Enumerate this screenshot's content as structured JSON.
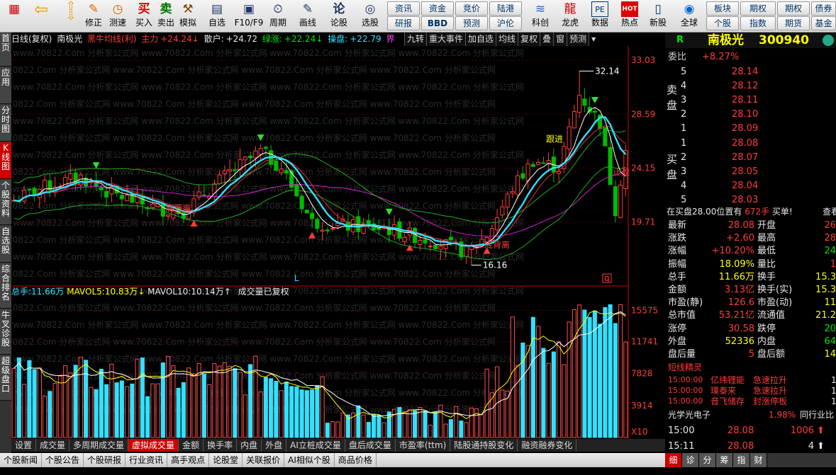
{
  "toolbar": {
    "left": [
      {
        "name": "home-button",
        "label": "",
        "icon": "▦"
      },
      {
        "name": "back-button",
        "label": "",
        "icon": "⇦"
      },
      {
        "name": "prev-button",
        "label": "",
        "icon": "⇧"
      },
      {
        "name": "edit-button",
        "label": "修正",
        "icon": "✎"
      },
      {
        "name": "test-button",
        "label": "测速",
        "icon": "◷"
      },
      {
        "name": "buy-button",
        "label": "买入",
        "icon": "买"
      },
      {
        "name": "sell-button",
        "label": "卖出",
        "icon": "卖"
      },
      {
        "name": "simulate-button",
        "label": "模拟",
        "icon": "⚒"
      },
      {
        "name": "watchlist-button",
        "label": "自选",
        "icon": "▤"
      },
      {
        "name": "f10-button",
        "label": "F10/F9",
        "icon": "▣"
      },
      {
        "name": "period-button",
        "label": "周期",
        "icon": "⏲"
      },
      {
        "name": "draw-button",
        "label": "画线",
        "icon": "✎"
      },
      {
        "name": "discuss-button",
        "label": "论股",
        "icon": "论"
      },
      {
        "name": "select-stock-button",
        "label": "选股",
        "icon": "◎"
      }
    ],
    "mid": [
      [
        "资讯",
        "资金",
        "竞价",
        "陆港"
      ],
      [
        "研报",
        "BBD",
        "预测",
        "沪伦"
      ]
    ],
    "right": [
      {
        "name": "kechuang-button",
        "label": "科创",
        "icon": "≋"
      },
      {
        "name": "longhu-button",
        "label": "龙虎",
        "icon": "龍"
      },
      {
        "name": "data-button",
        "label": "数据",
        "icon": "PE"
      },
      {
        "name": "hot-button",
        "label": "热点",
        "icon": "HOT"
      },
      {
        "name": "ipo-button",
        "label": "新股",
        "icon": "▯"
      },
      {
        "name": "global-button",
        "label": "全球",
        "icon": "◉"
      }
    ],
    "far": [
      [
        "板块",
        "期权",
        "期权",
        "债券"
      ],
      [
        "个股",
        "指数",
        "期货",
        "基金"
      ]
    ]
  },
  "lefttabs": [
    "首页",
    "应用",
    "分时图",
    "K线图",
    "个股资料",
    "自选股",
    "综合排名",
    "牛叉诊股",
    "超级盘口"
  ],
  "header": {
    "mode": "日线(复权)",
    "name": "南极光",
    "indicator": "黑牛均线(利)",
    "zhuli_label": "主力",
    "zhuli_val": "+24.24↓",
    "sanhu_label": "散户:",
    "sanhu_val": "+24.72",
    "lvzhang_label": "绿涨:",
    "lvzhang_val": "+22.24↓",
    "caopan_label": "操盘:",
    "caopan_val": "+22.79",
    "jie": "界"
  },
  "chart_tools": [
    "九转",
    "重大事件",
    "加自选",
    "均线",
    "复权",
    "叠",
    "窗",
    "预测"
  ],
  "watermark": "www.70822.Com 分析家公式网",
  "price_axis": [
    "33.03",
    "28.59",
    "24.15",
    "19.71"
  ],
  "vol_axis": [
    "15575",
    "11741",
    "7828",
    "3914",
    "X10"
  ],
  "annotations": {
    "high": "32.14",
    "low": "16.16",
    "jinjing": "跟进",
    "dibei": "底背离",
    "zhiying": "止盈",
    "escape": "逃离",
    "dibei2": "底背离",
    "L": "L",
    "q": "q"
  },
  "vol_header": {
    "total_label": "总手:",
    "total_val": "11.66万",
    "mavol5_label": "MAVOL5:",
    "mavol5_val": "10.83万↓",
    "mavol10_label": "MAVOL10:",
    "mavol10_val": "10.14万↑",
    "note": "成交量已复权"
  },
  "quote": {
    "r": "R",
    "name": "南极光",
    "code": "300940",
    "weibi_label": "委比",
    "weibi_val": "+8.27%",
    "sell": [
      [
        "5",
        "28.14"
      ],
      [
        "4",
        "28.12"
      ],
      [
        "3",
        "28.11"
      ],
      [
        "2",
        "28.10"
      ],
      [
        "1",
        "28.09"
      ]
    ],
    "buy": [
      [
        "1",
        "28.08"
      ],
      [
        "2",
        "28.07"
      ],
      [
        "3",
        "28.05"
      ],
      [
        "4",
        "28.04"
      ],
      [
        "5",
        "28.03"
      ]
    ],
    "sell_label": "卖盘",
    "buy_label": "买盘",
    "notice_a": "在买盘28.00位置有",
    "notice_b": "672手",
    "notice_c": "买单!",
    "notice_d": "查看",
    "stats": [
      [
        "最新",
        "28.08",
        "开盘",
        "26"
      ],
      [
        "涨跌",
        "+2.60",
        "最高",
        "28"
      ],
      [
        "涨幅",
        "+10.20%",
        "最低",
        "24"
      ],
      [
        "振幅",
        "18.09%",
        "量比",
        "1"
      ],
      [
        "总手",
        "11.66万",
        "换手",
        "15.3"
      ],
      [
        "金额",
        "3.13亿",
        "换手(实)",
        "15.3"
      ],
      [
        "市盈(静)",
        "126.6",
        "市盈(动)",
        "11"
      ],
      [
        "总市值",
        "53.21亿",
        "流通值",
        "21.2"
      ],
      [
        "涨停",
        "30.58",
        "跌停",
        "20"
      ],
      [
        "外盘",
        "52336",
        "内盘",
        "64"
      ],
      [
        "盘后量",
        "5",
        "盘后额",
        "14"
      ]
    ],
    "short_title": "短线精灵",
    "short": [
      [
        "15:00:00",
        "亿纬锂能",
        "急速拉升",
        "1"
      ],
      [
        "15:00:00",
        "璞泰来",
        "急速拉升",
        "1"
      ],
      [
        "15:00:00",
        "音飞储存",
        "封涨停板",
        "1"
      ]
    ],
    "industry_name": "光学光电子",
    "industry_pct": "1.98%",
    "industry_cmp": "同行业比",
    "ticks": [
      [
        "15:00",
        "28.08",
        "1006"
      ],
      [
        "15:11",
        "28.08",
        "4"
      ]
    ]
  },
  "bottom_tabs": [
    "设置",
    "成交量",
    "多周期成交量",
    "虚拟成交量",
    "金额",
    "换手率",
    "内盘",
    "外盘",
    "AI立桩成交量",
    "盘后成交量",
    "市盈率(ttm)",
    "陆股通持股变化",
    "融资融券变化"
  ],
  "status_tabs": [
    "个股新闻",
    "个股公告",
    "个股研报",
    "行业资讯",
    "高手观点",
    "论股堂",
    "关联报价",
    "AI相似个股",
    "商品价格"
  ],
  "right_tabs": [
    "细",
    "诊",
    "分",
    "筹",
    "指",
    "财"
  ],
  "colors": {
    "up": "#ff3c3c",
    "down": "#00e600",
    "flat": "#33e0ff",
    "vol_up": "#ff5050",
    "vol_down": "#33e0ff"
  }
}
